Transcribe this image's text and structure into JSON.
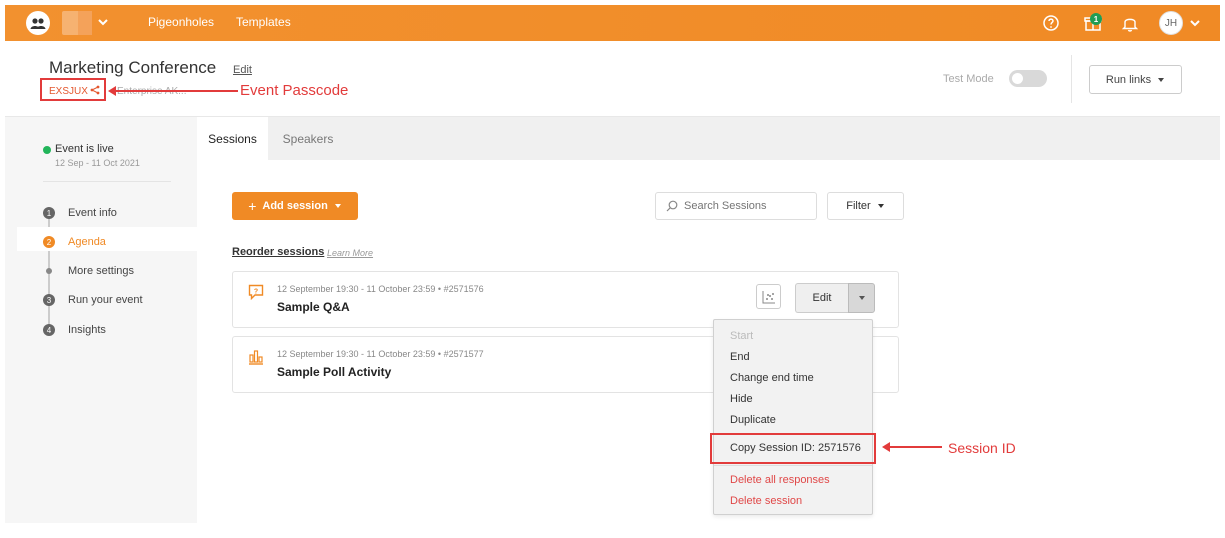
{
  "topbar": {
    "nav": [
      "Pigeonholes",
      "Templates"
    ],
    "gift_badge": "1",
    "avatar": "JH"
  },
  "header": {
    "title": "Marketing Conference",
    "edit_label": "Edit",
    "passcode": "EXSJUX",
    "org_name": "Enterprise AK...",
    "annotation_passcode": "Event Passcode",
    "test_mode": "Test Mode",
    "run_links": "Run links"
  },
  "sidebar": {
    "status": "Event is live",
    "date_range": "12 Sep - 11 Oct 2021",
    "steps": [
      {
        "num": "1",
        "label": "Event info"
      },
      {
        "num": "2",
        "label": "Agenda"
      },
      {
        "num": "",
        "label": "More settings"
      },
      {
        "num": "3",
        "label": "Run your event"
      },
      {
        "num": "4",
        "label": "Insights"
      }
    ]
  },
  "main": {
    "tabs": [
      "Sessions",
      "Speakers"
    ],
    "add_session": "Add session",
    "search_placeholder": "Search Sessions",
    "filter": "Filter",
    "reorder": "Reorder sessions",
    "learn_more": "Learn More",
    "sessions": [
      {
        "meta": "12 September 19:30 - 11 October 23:59  •  #2571576",
        "name": "Sample Q&A",
        "icon": "qa-icon"
      },
      {
        "meta": "12 September 19:30 - 11 October 23:59  •  #2571577",
        "name": "Sample Poll Activity",
        "icon": "poll-icon"
      }
    ],
    "edit": "Edit"
  },
  "dropdown": {
    "start": "Start",
    "end": "End",
    "change_end_time": "Change end time",
    "hide": "Hide",
    "duplicate": "Duplicate",
    "copy_id": "Copy Session ID: 2571576",
    "delete_responses": "Delete all responses",
    "delete_session": "Delete session"
  },
  "annotation_session_id": "Session ID",
  "colors": {
    "brand": "#f08a25",
    "live": "#22b55a",
    "annotation": "#e23b3b",
    "danger": "#e04848"
  }
}
